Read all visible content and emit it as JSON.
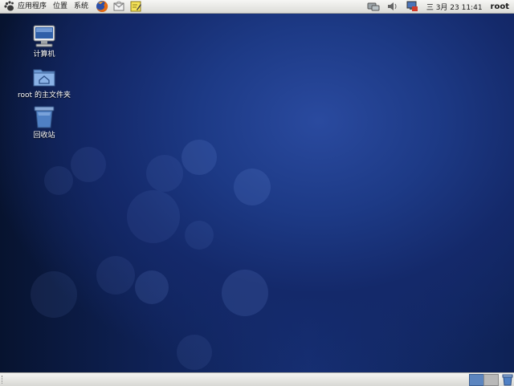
{
  "top_panel": {
    "menus": [
      {
        "label": "应用程序"
      },
      {
        "label": "位置"
      },
      {
        "label": "系统"
      }
    ],
    "launchers": [
      {
        "icon": "firefox-icon"
      },
      {
        "icon": "mail-icon"
      },
      {
        "icon": "notes-icon"
      }
    ],
    "tray": [
      {
        "icon": "network-icon"
      },
      {
        "icon": "volume-icon"
      },
      {
        "icon": "update-alert-icon"
      }
    ],
    "clock": "三  3月 23 11:41",
    "user": "root"
  },
  "desktop": {
    "icons": [
      {
        "label": "计算机",
        "icon": "computer-icon"
      },
      {
        "label": "root 的主文件夹",
        "icon": "home-folder-icon"
      },
      {
        "label": "回收站",
        "icon": "trash-icon"
      }
    ]
  },
  "bottom_panel": {
    "workspaces": [
      {
        "name": "workspace-1",
        "active": true
      },
      {
        "name": "workspace-2",
        "active": false
      }
    ]
  },
  "colors": {
    "desktop_blue": "#1d3a86",
    "panel_bg": "#e6e6e2",
    "workspace_active": "#5c85bf"
  }
}
